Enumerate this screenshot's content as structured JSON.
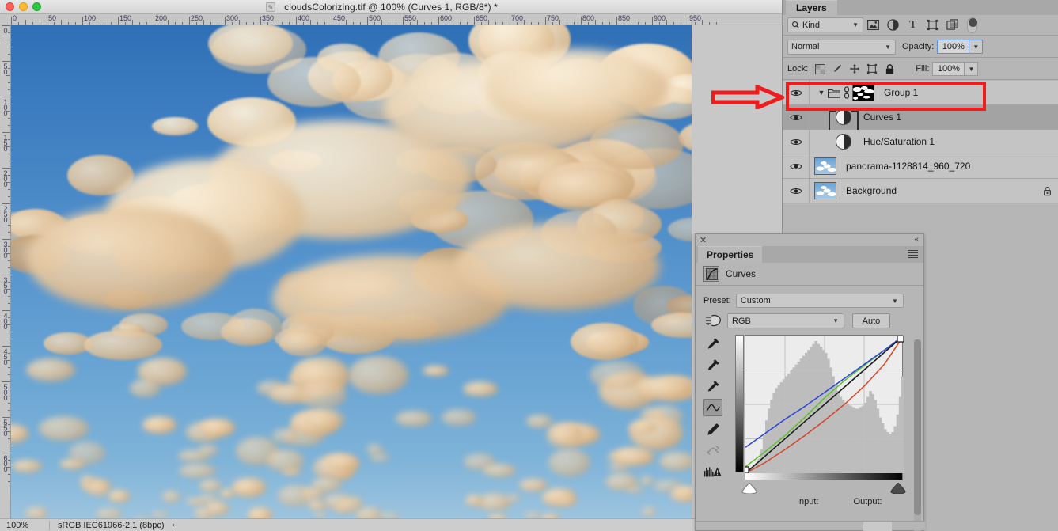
{
  "window": {
    "title": "cloudsColorizing.tif @ 100% (Curves 1, RGB/8*) *",
    "doc_icon": "document-icon"
  },
  "rulers": {
    "unit_step": 50,
    "h_labels": [
      "0",
      "50",
      "100",
      "150",
      "200",
      "250",
      "300",
      "350",
      "400",
      "450",
      "500",
      "550",
      "600",
      "650",
      "700",
      "750",
      "800",
      "850",
      "900",
      "950"
    ],
    "v_labels": [
      "0",
      "50",
      "100",
      "150",
      "200",
      "250",
      "300",
      "350",
      "400",
      "450",
      "500",
      "550",
      "600"
    ]
  },
  "status_bar": {
    "zoom": "100%",
    "color_profile": "sRGB IEC61966-2.1 (8bpc)",
    "expand_arrow": "›"
  },
  "layers_panel": {
    "tab_label": "Layers",
    "filter": {
      "kind_label": "Kind",
      "search_icon": "search-icon",
      "icons": [
        "pixel-layer-filter-icon",
        "adjustment-layer-filter-icon",
        "type-layer-filter-icon",
        "shape-layer-filter-icon",
        "smart-object-filter-icon"
      ],
      "toggle": "filter-enable-toggle"
    },
    "blend": {
      "mode": "Normal",
      "opacity_label": "Opacity:",
      "opacity_value": "100%"
    },
    "lock": {
      "label": "Lock:",
      "icons": [
        "lock-transparent-pixels-icon",
        "lock-image-pixels-icon",
        "lock-position-icon",
        "lock-artboard-icon",
        "lock-all-icon"
      ],
      "fill_label": "Fill:",
      "fill_value": "100%"
    },
    "rows": [
      {
        "name": "Group 1",
        "type": "group",
        "visible": true,
        "selected": false,
        "expanded": true,
        "linked": true,
        "thumb": "layer-mask-thumbnail",
        "locked": false,
        "highlighted": true
      },
      {
        "name": "Curves 1",
        "type": "adjustment",
        "visible": true,
        "selected": true,
        "indent": true,
        "thumb": "adjustment-thumbnail",
        "locked": false,
        "highlighted": false
      },
      {
        "name": "Hue/Saturation 1",
        "type": "adjustment",
        "visible": true,
        "selected": false,
        "indent": true,
        "thumb": "adjustment-thumbnail",
        "locked": false,
        "highlighted": false
      },
      {
        "name": "panorama-1128814_960_720",
        "type": "pixel",
        "visible": true,
        "selected": false,
        "indent": false,
        "thumb": "photo-thumbnail",
        "locked": false,
        "highlighted": false
      },
      {
        "name": "Background",
        "type": "pixel",
        "visible": true,
        "selected": false,
        "indent": false,
        "thumb": "photo-thumbnail",
        "locked": true,
        "highlighted": false
      }
    ]
  },
  "annotation": {
    "arrow": "red-pointer-arrow",
    "highlight_color": "#ee1c1c",
    "target_row": "Group 1"
  },
  "properties_panel": {
    "tab_label": "Properties",
    "close_icon": "close-icon",
    "collapse_icon": "collapse-panel-icon",
    "menu_icon": "panel-menu-icon",
    "header_label": "Curves",
    "header_icon": "curves-adjustment-icon",
    "preset_label": "Preset:",
    "preset_value": "Custom",
    "channel_value": "RGB",
    "auto_label": "Auto",
    "tools": [
      "targeted-adjustment-icon",
      "black-point-eyedropper-icon",
      "gray-point-eyedropper-icon",
      "white-point-eyedropper-icon",
      "curve-point-tool-icon",
      "pencil-draw-curve-icon",
      "smooth-curve-icon",
      "histogram-warning-icon"
    ],
    "active_tool": "curve-point-tool-icon",
    "input_label": "Input:",
    "output_label": "Output:",
    "input_value": "",
    "output_value": ""
  },
  "chart_data": {
    "type": "line",
    "title": "Curves adjustment",
    "xlabel": "Input",
    "ylabel": "Output",
    "xlim": [
      0,
      255
    ],
    "ylim": [
      0,
      255
    ],
    "grid": true,
    "legend": "none",
    "series": [
      {
        "name": "RGB composite",
        "color": "#1a1a1a",
        "points": [
          [
            0,
            0
          ],
          [
            64,
            64
          ],
          [
            128,
            128
          ],
          [
            192,
            192
          ],
          [
            255,
            255
          ]
        ]
      },
      {
        "name": "Blue",
        "color": "#2a44d8",
        "points": [
          [
            0,
            48
          ],
          [
            32,
            74
          ],
          [
            64,
            100
          ],
          [
            96,
            124
          ],
          [
            128,
            150
          ],
          [
            160,
            176
          ],
          [
            192,
            202
          ],
          [
            224,
            228
          ],
          [
            255,
            255
          ]
        ]
      },
      {
        "name": "Green",
        "color": "#5cc02c",
        "points": [
          [
            0,
            12
          ],
          [
            32,
            40
          ],
          [
            64,
            70
          ],
          [
            96,
            104
          ],
          [
            128,
            140
          ],
          [
            160,
            172
          ],
          [
            192,
            200
          ],
          [
            224,
            228
          ],
          [
            255,
            255
          ]
        ]
      },
      {
        "name": "Red",
        "color": "#d4462a",
        "points": [
          [
            0,
            0
          ],
          [
            32,
            20
          ],
          [
            64,
            44
          ],
          [
            96,
            70
          ],
          [
            128,
            98
          ],
          [
            160,
            128
          ],
          [
            192,
            162
          ],
          [
            224,
            202
          ],
          [
            255,
            255
          ]
        ]
      }
    ],
    "histogram": {
      "bins": 64,
      "values": [
        2,
        3,
        4,
        5,
        7,
        10,
        16,
        26,
        36,
        44,
        50,
        55,
        58,
        60,
        62,
        64,
        66,
        68,
        70,
        72,
        74,
        76,
        78,
        80,
        82,
        84,
        86,
        88,
        90,
        88,
        86,
        84,
        82,
        78,
        72,
        66,
        60,
        56,
        52,
        50,
        48,
        47,
        46,
        45,
        44,
        44,
        45,
        46,
        48,
        52,
        56,
        54,
        50,
        44,
        38,
        34,
        30,
        28,
        27,
        28,
        32,
        40,
        52,
        66
      ]
    },
    "black_point_slider": 0,
    "white_point_slider": 255
  },
  "canvas": {
    "image_name": "clouds-photo",
    "description": "sky-with-golden-clouds"
  }
}
